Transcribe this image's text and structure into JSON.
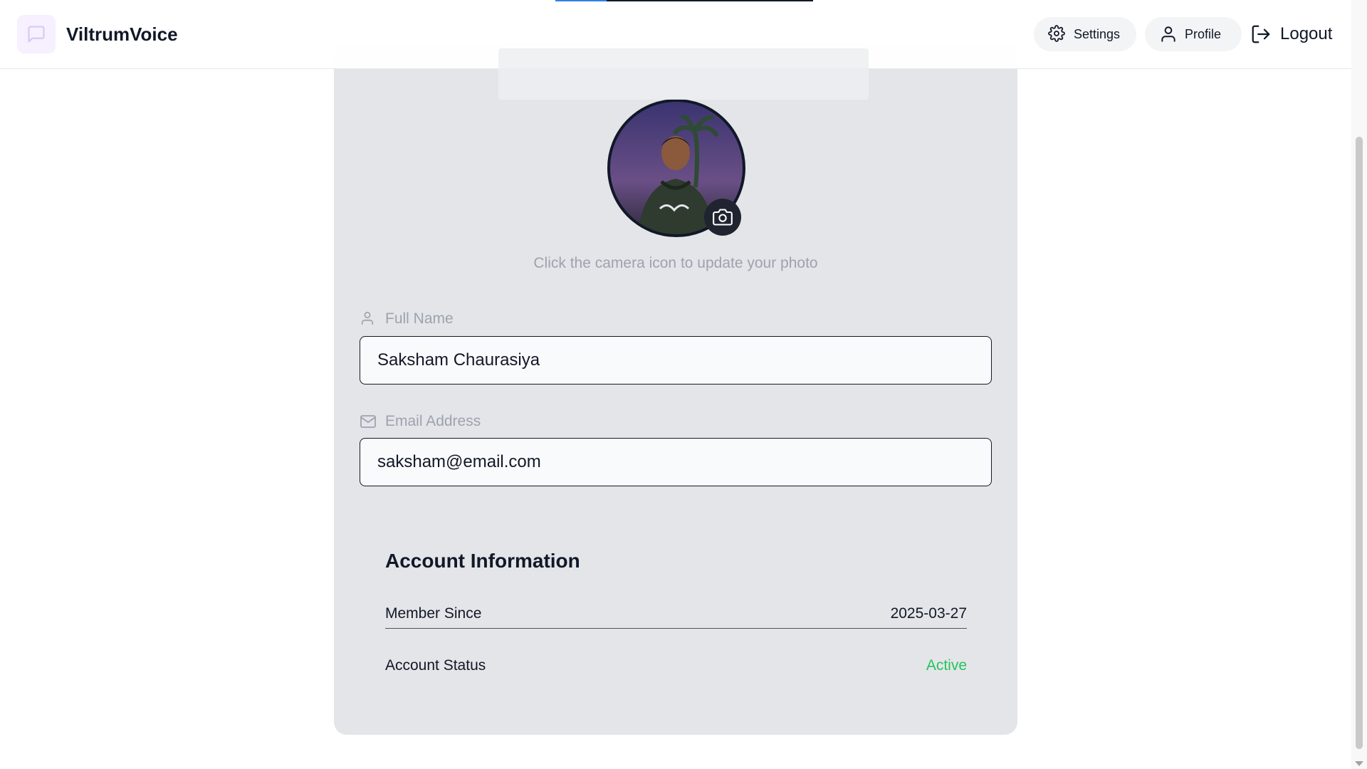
{
  "header": {
    "brand": "ViltrumVoice",
    "logo_icon": "message-square-icon",
    "nav": {
      "settings_label": "Settings",
      "profile_label": "Profile",
      "logout_label": "Logout"
    }
  },
  "progress": {
    "value_percent": 20
  },
  "profile": {
    "photo_hint": "Click the camera icon to update your photo",
    "camera_icon": "camera-icon",
    "full_name": {
      "label": "Full Name",
      "value": "Saksham Chaurasiya",
      "icon": "user-icon"
    },
    "email": {
      "label": "Email Address",
      "value": "saksham@email.com",
      "icon": "mail-icon"
    }
  },
  "account": {
    "title": "Account Information",
    "member_since_label": "Member Since",
    "member_since_value": "2025-03-27",
    "status_label": "Account Status",
    "status_value": "Active"
  },
  "colors": {
    "accent": "#2f80ed",
    "status_active": "#22c55e",
    "card_bg": "#e4e5e8"
  }
}
